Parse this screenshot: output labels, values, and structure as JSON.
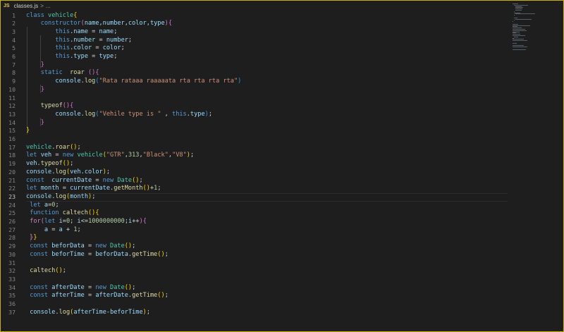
{
  "breadcrumb": {
    "badge": "JS",
    "file": "classes.js",
    "separator": ">",
    "more": "..."
  },
  "editor": {
    "active_line": 23,
    "lines": [
      {
        "n": "1",
        "tokens": [
          {
            "t": "class ",
            "c": "kw"
          },
          {
            "t": "vehicle",
            "c": "cls"
          },
          {
            "t": "{",
            "c": "p1"
          }
        ]
      },
      {
        "n": "2",
        "tokens": [
          {
            "t": "    "
          },
          {
            "t": "constructor",
            "c": "kw"
          },
          {
            "t": "(",
            "c": "p2"
          },
          {
            "t": "name,number,color,type",
            "c": "var"
          },
          {
            "t": ")",
            "c": "p2"
          },
          {
            "t": "{",
            "c": "p2"
          }
        ]
      },
      {
        "n": "3",
        "tokens": [
          {
            "t": "        "
          },
          {
            "t": "this",
            "c": "kw"
          },
          {
            "t": "."
          },
          {
            "t": "name",
            "c": "var"
          },
          {
            "t": " = "
          },
          {
            "t": "name",
            "c": "var"
          },
          {
            "t": ";"
          }
        ]
      },
      {
        "n": "4",
        "tokens": [
          {
            "t": "        "
          },
          {
            "t": "this",
            "c": "kw"
          },
          {
            "t": "."
          },
          {
            "t": "number",
            "c": "var"
          },
          {
            "t": " = "
          },
          {
            "t": "number",
            "c": "var"
          },
          {
            "t": ";"
          }
        ]
      },
      {
        "n": "5",
        "tokens": [
          {
            "t": "        "
          },
          {
            "t": "this",
            "c": "kw"
          },
          {
            "t": "."
          },
          {
            "t": "color",
            "c": "var"
          },
          {
            "t": " = "
          },
          {
            "t": "color",
            "c": "var"
          },
          {
            "t": ";"
          }
        ]
      },
      {
        "n": "6",
        "tokens": [
          {
            "t": "        "
          },
          {
            "t": "this",
            "c": "kw"
          },
          {
            "t": "."
          },
          {
            "t": "type",
            "c": "var"
          },
          {
            "t": " = "
          },
          {
            "t": "type",
            "c": "var"
          },
          {
            "t": ";"
          }
        ]
      },
      {
        "n": "7",
        "tokens": [
          {
            "t": "    "
          },
          {
            "t": "}",
            "c": "p2"
          }
        ]
      },
      {
        "n": "8",
        "tokens": [
          {
            "t": "    "
          },
          {
            "t": "static",
            "c": "kw"
          },
          {
            "t": "  "
          },
          {
            "t": "roar",
            "c": "fn"
          },
          {
            "t": " "
          },
          {
            "t": "()",
            "c": "p2"
          },
          {
            "t": "{",
            "c": "p2"
          }
        ]
      },
      {
        "n": "9",
        "tokens": [
          {
            "t": "        "
          },
          {
            "t": "console",
            "c": "var"
          },
          {
            "t": "."
          },
          {
            "t": "log",
            "c": "fn"
          },
          {
            "t": "(",
            "c": "p3"
          },
          {
            "t": "\"Rata rataaa raaaaata rta rta rta rta\"",
            "c": "str"
          },
          {
            "t": ")",
            "c": "p3"
          }
        ]
      },
      {
        "n": "10",
        "tokens": [
          {
            "t": "    "
          },
          {
            "t": "}",
            "c": "p2"
          }
        ]
      },
      {
        "n": "11",
        "tokens": []
      },
      {
        "n": "12",
        "tokens": [
          {
            "t": "    "
          },
          {
            "t": "typeof",
            "c": "fn"
          },
          {
            "t": "()",
            "c": "p2"
          },
          {
            "t": "{",
            "c": "p2"
          }
        ]
      },
      {
        "n": "13",
        "tokens": [
          {
            "t": "        "
          },
          {
            "t": "console",
            "c": "var"
          },
          {
            "t": "."
          },
          {
            "t": "log",
            "c": "fn"
          },
          {
            "t": "(",
            "c": "p3"
          },
          {
            "t": "\"Vehile type is \"",
            "c": "str"
          },
          {
            "t": " , "
          },
          {
            "t": "this",
            "c": "kw"
          },
          {
            "t": "."
          },
          {
            "t": "type",
            "c": "var"
          },
          {
            "t": ")",
            "c": "p3"
          },
          {
            "t": ";"
          }
        ]
      },
      {
        "n": "14",
        "tokens": [
          {
            "t": "    "
          },
          {
            "t": "}",
            "c": "p2"
          }
        ]
      },
      {
        "n": "15",
        "tokens": [
          {
            "t": "}",
            "c": "p1"
          }
        ]
      },
      {
        "n": "16",
        "tokens": []
      },
      {
        "n": "17",
        "tokens": [
          {
            "t": "vehicle",
            "c": "cls"
          },
          {
            "t": "."
          },
          {
            "t": "roar",
            "c": "fn"
          },
          {
            "t": "()",
            "c": "p1"
          },
          {
            "t": ";"
          }
        ]
      },
      {
        "n": "18",
        "tokens": [
          {
            "t": "let ",
            "c": "kw"
          },
          {
            "t": "veh",
            "c": "var"
          },
          {
            "t": " = "
          },
          {
            "t": "new ",
            "c": "kw"
          },
          {
            "t": "vehicle",
            "c": "cls"
          },
          {
            "t": "(",
            "c": "p1"
          },
          {
            "t": "\"GTR\"",
            "c": "str"
          },
          {
            "t": ","
          },
          {
            "t": "313",
            "c": "num"
          },
          {
            "t": ","
          },
          {
            "t": "\"Black\"",
            "c": "str"
          },
          {
            "t": ","
          },
          {
            "t": "\"V8\"",
            "c": "str"
          },
          {
            "t": ")",
            "c": "p1"
          },
          {
            "t": ";"
          }
        ]
      },
      {
        "n": "19",
        "tokens": [
          {
            "t": "veh",
            "c": "var"
          },
          {
            "t": "."
          },
          {
            "t": "typeof",
            "c": "fn"
          },
          {
            "t": "()",
            "c": "p1"
          },
          {
            "t": ";"
          }
        ]
      },
      {
        "n": "20",
        "tokens": [
          {
            "t": "console",
            "c": "var"
          },
          {
            "t": "."
          },
          {
            "t": "log",
            "c": "fn"
          },
          {
            "t": "(",
            "c": "p1"
          },
          {
            "t": "veh",
            "c": "var"
          },
          {
            "t": "."
          },
          {
            "t": "color",
            "c": "var"
          },
          {
            "t": ")",
            "c": "p1"
          },
          {
            "t": ";"
          }
        ]
      },
      {
        "n": "21",
        "tokens": [
          {
            "t": "const ",
            "c": "kw"
          },
          {
            "t": " currentDate",
            "c": "var"
          },
          {
            "t": " = "
          },
          {
            "t": "new ",
            "c": "kw"
          },
          {
            "t": "Date",
            "c": "cls"
          },
          {
            "t": "()",
            "c": "p1"
          },
          {
            "t": ";"
          }
        ]
      },
      {
        "n": "22",
        "tokens": [
          {
            "t": "let ",
            "c": "kw"
          },
          {
            "t": "month",
            "c": "var"
          },
          {
            "t": " = "
          },
          {
            "t": "currentDate",
            "c": "var"
          },
          {
            "t": "."
          },
          {
            "t": "getMonth",
            "c": "fn"
          },
          {
            "t": "()",
            "c": "p1"
          },
          {
            "t": "+"
          },
          {
            "t": "1",
            "c": "num"
          },
          {
            "t": ";"
          }
        ]
      },
      {
        "n": "23",
        "tokens": [
          {
            "t": "console",
            "c": "var"
          },
          {
            "t": "."
          },
          {
            "t": "log",
            "c": "fn"
          },
          {
            "t": "(",
            "c": "p1"
          },
          {
            "t": "month",
            "c": "var"
          },
          {
            "t": ")",
            "c": "p1"
          },
          {
            "t": ";"
          }
        ]
      },
      {
        "n": "24",
        "tokens": [
          {
            "t": " "
          },
          {
            "t": "let ",
            "c": "kw"
          },
          {
            "t": "a",
            "c": "var"
          },
          {
            "t": "="
          },
          {
            "t": "0",
            "c": "num"
          },
          {
            "t": ";"
          }
        ]
      },
      {
        "n": "25",
        "tokens": [
          {
            "t": " "
          },
          {
            "t": "function ",
            "c": "kw"
          },
          {
            "t": "caltech",
            "c": "fn"
          },
          {
            "t": "()",
            "c": "p1"
          },
          {
            "t": "{",
            "c": "p1"
          }
        ]
      },
      {
        "n": "26",
        "tokens": [
          {
            "t": " "
          },
          {
            "t": "for",
            "c": "ctl"
          },
          {
            "t": "(",
            "c": "p2"
          },
          {
            "t": "let ",
            "c": "kw"
          },
          {
            "t": "i",
            "c": "var"
          },
          {
            "t": "="
          },
          {
            "t": "0",
            "c": "num"
          },
          {
            "t": "; "
          },
          {
            "t": "i",
            "c": "var"
          },
          {
            "t": "<="
          },
          {
            "t": "1000000000",
            "c": "num"
          },
          {
            "t": ";"
          },
          {
            "t": "i",
            "c": "var"
          },
          {
            "t": "++"
          },
          {
            "t": ")",
            "c": "p2"
          },
          {
            "t": "{",
            "c": "p2"
          }
        ]
      },
      {
        "n": "27",
        "tokens": [
          {
            "t": "     "
          },
          {
            "t": "a",
            "c": "var"
          },
          {
            "t": " = "
          },
          {
            "t": "a",
            "c": "var"
          },
          {
            "t": " + "
          },
          {
            "t": "1",
            "c": "num"
          },
          {
            "t": ";"
          }
        ]
      },
      {
        "n": "28",
        "tokens": [
          {
            "t": " "
          },
          {
            "t": "}",
            "c": "p2"
          },
          {
            "t": "}",
            "c": "p1"
          }
        ]
      },
      {
        "n": "29",
        "tokens": [
          {
            "t": " "
          },
          {
            "t": "const ",
            "c": "kw"
          },
          {
            "t": "beforData",
            "c": "var"
          },
          {
            "t": " = "
          },
          {
            "t": "new ",
            "c": "kw"
          },
          {
            "t": "Date",
            "c": "cls"
          },
          {
            "t": "()",
            "c": "p1"
          },
          {
            "t": ";"
          }
        ]
      },
      {
        "n": "30",
        "tokens": [
          {
            "t": " "
          },
          {
            "t": "const ",
            "c": "kw"
          },
          {
            "t": "beforTime",
            "c": "var"
          },
          {
            "t": " = "
          },
          {
            "t": "beforData",
            "c": "var"
          },
          {
            "t": "."
          },
          {
            "t": "getTime",
            "c": "fn"
          },
          {
            "t": "()",
            "c": "p1"
          },
          {
            "t": ";"
          }
        ]
      },
      {
        "n": "31",
        "tokens": []
      },
      {
        "n": "32",
        "tokens": [
          {
            "t": " "
          },
          {
            "t": "caltech",
            "c": "fn"
          },
          {
            "t": "()",
            "c": "p1"
          },
          {
            "t": ";"
          }
        ]
      },
      {
        "n": "33",
        "tokens": []
      },
      {
        "n": "34",
        "tokens": [
          {
            "t": " "
          },
          {
            "t": "const ",
            "c": "kw"
          },
          {
            "t": "afterDate",
            "c": "var"
          },
          {
            "t": " = "
          },
          {
            "t": "new ",
            "c": "kw"
          },
          {
            "t": "Date",
            "c": "cls"
          },
          {
            "t": "()",
            "c": "p1"
          },
          {
            "t": ";"
          }
        ]
      },
      {
        "n": "35",
        "tokens": [
          {
            "t": " "
          },
          {
            "t": "const ",
            "c": "kw"
          },
          {
            "t": "afterTime",
            "c": "var"
          },
          {
            "t": " = "
          },
          {
            "t": "afterDate",
            "c": "var"
          },
          {
            "t": "."
          },
          {
            "t": "getTime",
            "c": "fn"
          },
          {
            "t": "()",
            "c": "p1"
          },
          {
            "t": ";"
          }
        ]
      },
      {
        "n": "36",
        "tokens": []
      },
      {
        "n": "37",
        "tokens": [
          {
            "t": " "
          },
          {
            "t": "console",
            "c": "var"
          },
          {
            "t": "."
          },
          {
            "t": "log",
            "c": "fn"
          },
          {
            "t": "(",
            "c": "p1"
          },
          {
            "t": "afterTime",
            "c": "var"
          },
          {
            "t": "-"
          },
          {
            "t": "beforTime",
            "c": "var"
          },
          {
            "t": ")",
            "c": "p1"
          },
          {
            "t": ";"
          }
        ]
      }
    ]
  },
  "colors": {
    "background": "#1e1e1e",
    "border": "#c9b000",
    "keyword": "#569cd6",
    "function": "#dcdcaa",
    "string": "#ce9178",
    "number": "#b5cea8",
    "variable": "#9cdcfe",
    "class": "#4ec9b0"
  }
}
